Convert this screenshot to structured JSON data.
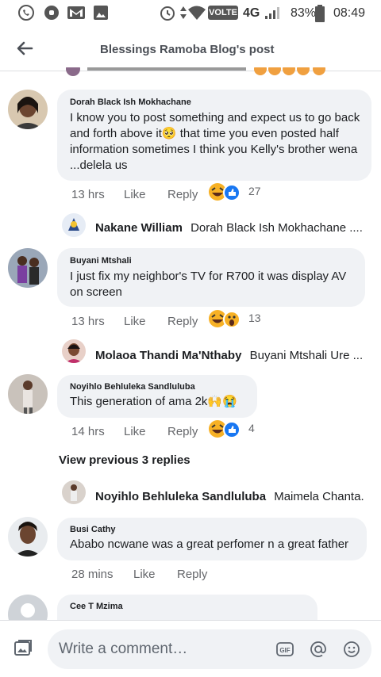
{
  "status_bar": {
    "network": "VOLTE",
    "signal": "4G",
    "battery": "83%",
    "time": "08:49"
  },
  "header": {
    "title": "Blessings Ramoba Blog's post"
  },
  "comments": [
    {
      "author": "Dorah Black Ish Mokhachane",
      "text": "I know you to post something and expect us to go back and forth above it🥺 that time you even posted half information sometimes I think you Kelly's brother wena ...delela us",
      "time": "13 hrs",
      "like": "Like",
      "reply": "Reply",
      "reactions": [
        "haha",
        "like"
      ],
      "reaction_count": "27",
      "reply_preview": {
        "name": "Nakane William",
        "text": "Dorah Black Ish Mokhachane ...."
      }
    },
    {
      "author": "Buyani Mtshali",
      "text": "I just fix my neighbor's TV for R700 it was display AV on screen",
      "time": "13 hrs",
      "like": "Like",
      "reply": "Reply",
      "reactions": [
        "haha",
        "wow"
      ],
      "reaction_count": "13",
      "reply_preview": {
        "name": "Molaoa Thandi Ma'Nthaby",
        "text": "Buyani Mtshali Ure ..."
      }
    },
    {
      "author": "Noyihlo Behluleka Sandluluba",
      "text": "This generation of ama 2k🙌😭",
      "time": "14 hrs",
      "like": "Like",
      "reply": "Reply",
      "reactions": [
        "haha",
        "like"
      ],
      "reaction_count": "4",
      "view_previous": "View previous 3 replies",
      "reply_preview": {
        "name": "Noyihlo Behluleka Sandluluba",
        "text": "Maimela Chanta..."
      }
    },
    {
      "author": "Busi Cathy",
      "text": "Ababo  ncwane was a great perfomer n a great father",
      "time": "28 mins",
      "like": "Like",
      "reply": "Reply"
    },
    {
      "author": "Cee T Mzima"
    }
  ],
  "composer": {
    "placeholder": "Write a comment…",
    "gif_label": "GIF"
  },
  "colors": {
    "bubble": "#f0f2f5",
    "like_blue": "#1877f2",
    "haha_yellow": "#f7b125",
    "wow_yellow": "#f7b125"
  }
}
